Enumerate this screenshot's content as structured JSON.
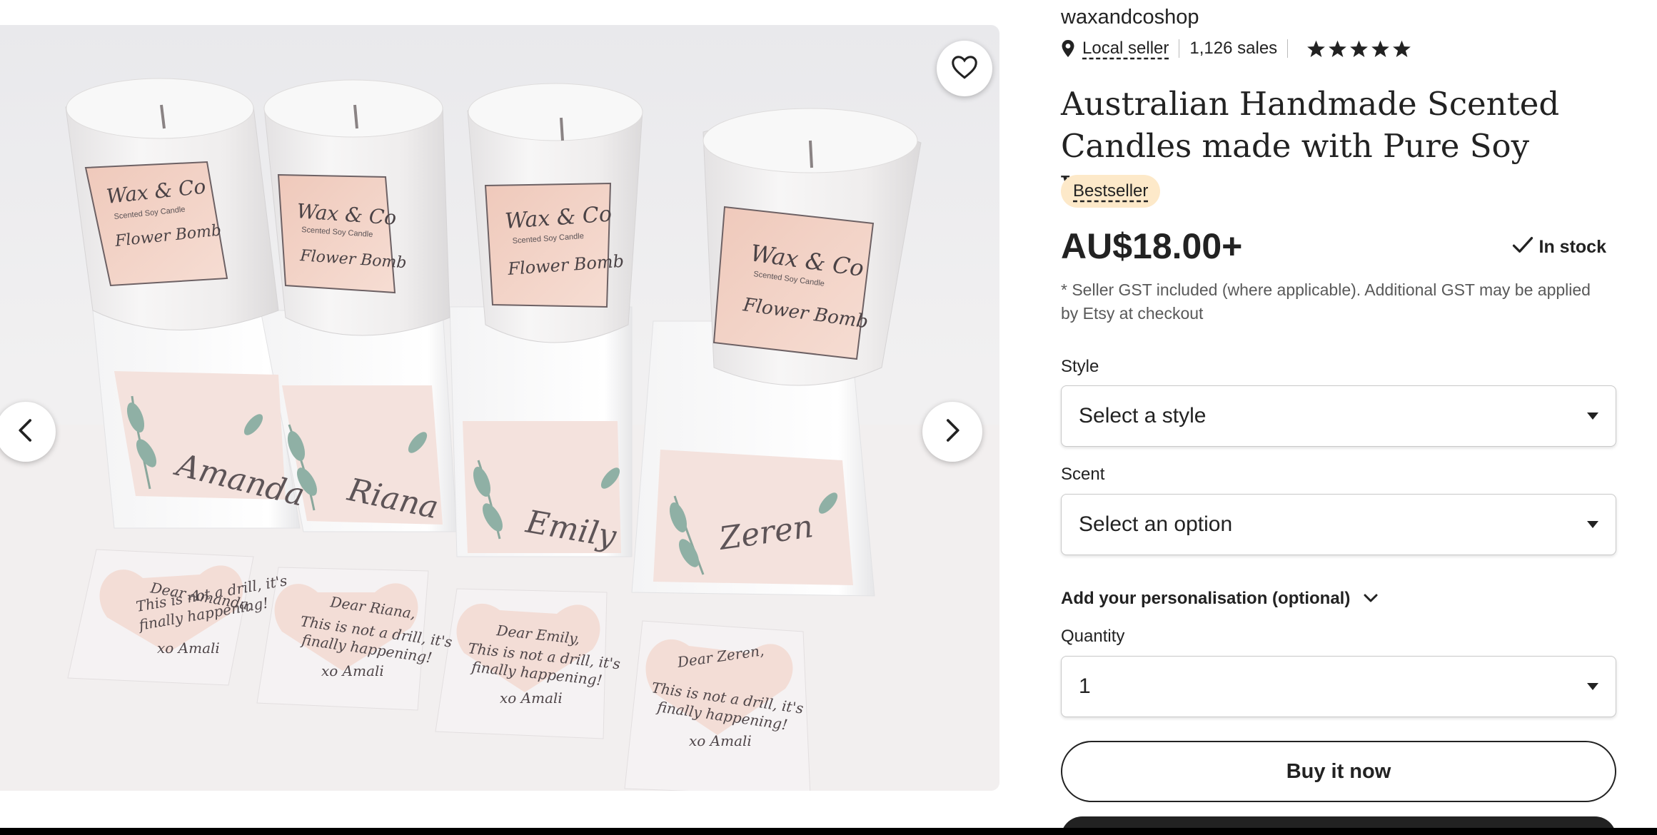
{
  "shop": {
    "name": "waxandcoshop",
    "local_seller_label": "Local seller",
    "sales": "1,126 sales",
    "rating_stars": 5
  },
  "listing": {
    "title": "Australian Handmade Scented Candles made with Pure Soy Wax.",
    "badge": "Bestseller",
    "price": "AU$18.00+",
    "stock_status": "In stock",
    "gst_note": "* Seller GST included (where applicable). Additional GST may be applied by Etsy at checkout"
  },
  "options": {
    "style_label": "Style",
    "style_value": "Select a style",
    "scent_label": "Scent",
    "scent_value": "Select an option",
    "personalisation_label": "Add your personalisation (optional)",
    "quantity_label": "Quantity",
    "quantity_value": "1"
  },
  "actions": {
    "buy_now": "Buy it now"
  },
  "gallery": {
    "image_labels": {
      "brand": "Wax & Co",
      "subtitle": "Scented Soy Candle",
      "scent": "Flower Bomb"
    },
    "names": [
      "Amanda",
      "Riana",
      "Emily",
      "Zeren"
    ],
    "cards": [
      {
        "greeting": "Dear Amanda,",
        "line1": "This is not a drill, it's",
        "line2": "finally happening!",
        "sign": "xo Amali"
      },
      {
        "greeting": "Dear Riana,",
        "line1": "This is not a drill, it's",
        "line2": "finally happening!",
        "sign": "xo Amali"
      },
      {
        "greeting": "Dear Emily,",
        "line1": "This is not a drill, it's",
        "line2": "finally happening!",
        "sign": "xo Amali"
      },
      {
        "greeting": "Dear Zeren,",
        "line1": "This is not a drill, it's",
        "line2": "finally happening!",
        "sign": "xo Amali"
      }
    ]
  },
  "colors": {
    "text": "#222222",
    "muted": "#595959",
    "badge_bg": "#fde9c9",
    "label_pink": "#f3d3c6",
    "page_bg": "#ffffff"
  },
  "icons": [
    "heart-icon",
    "chevron-left-icon",
    "chevron-right-icon",
    "map-pin-icon",
    "star-icon",
    "check-icon",
    "caret-down-icon",
    "chevron-down-icon"
  ]
}
